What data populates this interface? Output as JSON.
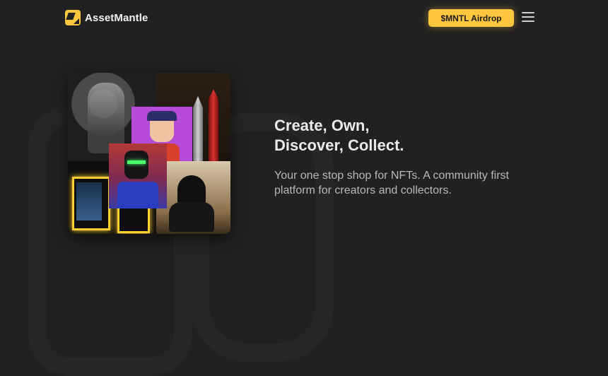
{
  "header": {
    "brand_name": "AssetMantle",
    "logo_icon": "assetmantle-logo-icon",
    "airdrop_button_label": "$MNTL Airdrop",
    "menu_icon": "hamburger-menu-icon"
  },
  "hero": {
    "title_line1": "Create, Own,",
    "title_line2": "Discover, Collect.",
    "subtitle_line1": "Your one stop shop for NFTs. A community first",
    "subtitle_line2": "platform for creators and collectors."
  },
  "colors": {
    "background": "#212121",
    "accent": "#ffc640",
    "text": "#eaeaea",
    "muted_text": "#b8b8b8"
  }
}
